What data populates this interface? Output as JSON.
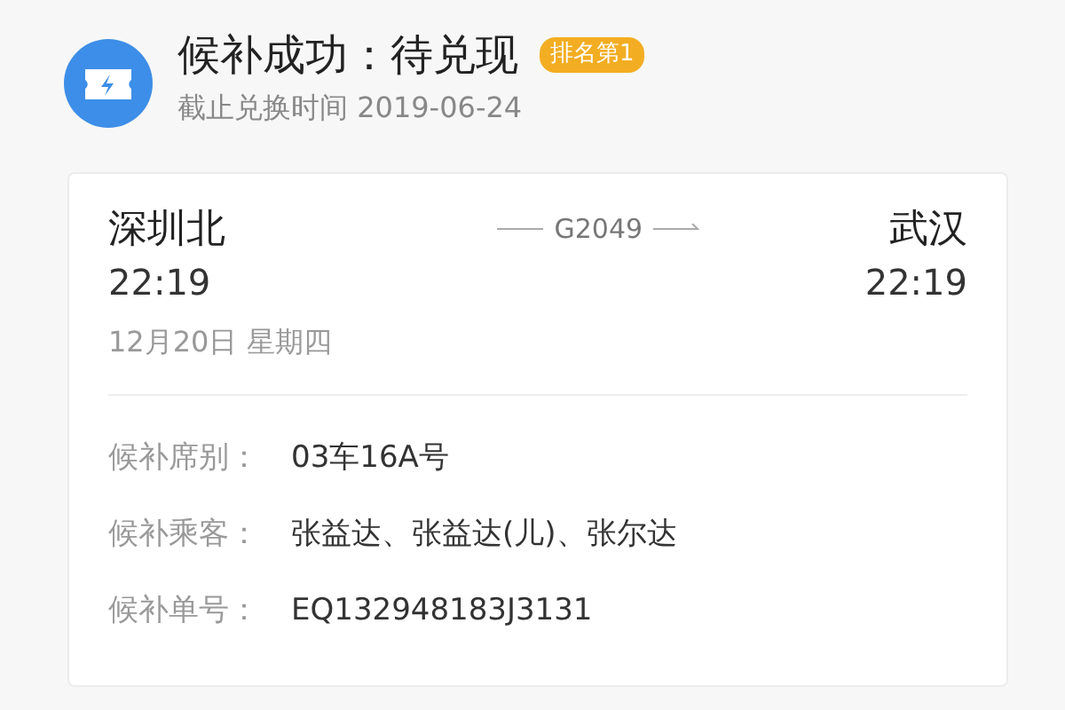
{
  "header": {
    "title": "候补成功：待兑现",
    "badge": "排名第1",
    "subtitle": "截止兑换时间 2019-06-24"
  },
  "trip": {
    "from": {
      "station": "深圳北",
      "time": "22:19"
    },
    "train": "G2049",
    "to": {
      "station": "武汉",
      "time": "22:19"
    },
    "date": "12月20日 星期四"
  },
  "details": [
    {
      "label": "候补席别：",
      "value": "03车16A号"
    },
    {
      "label": "候补乘客：",
      "value": "张益达、张益达(儿)、张尔达"
    },
    {
      "label": "候补单号：",
      "value": "EQ132948183J3131"
    }
  ]
}
